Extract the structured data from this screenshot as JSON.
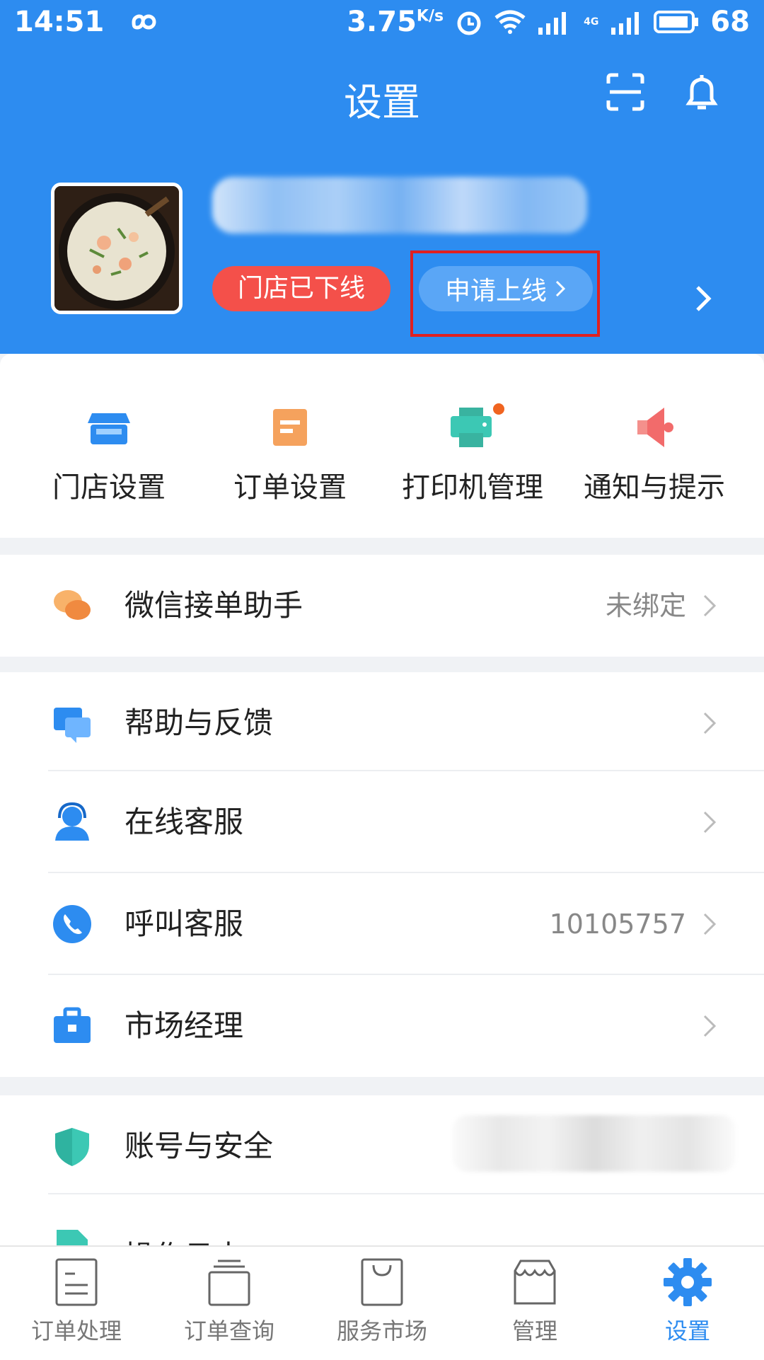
{
  "status_bar": {
    "time": "14:51",
    "speed": "3.75",
    "speed_unit": "K/s",
    "signal_gen": "4G",
    "battery": "68"
  },
  "header": {
    "title": "设置"
  },
  "profile": {
    "store_status": "门店已下线",
    "apply_online_label": "申请上线"
  },
  "shortcuts": [
    {
      "label": "门店设置",
      "icon": "store-icon",
      "color": "#2d8cf0"
    },
    {
      "label": "订单设置",
      "icon": "order-doc-icon",
      "color": "#f5a25d"
    },
    {
      "label": "打印机管理",
      "icon": "printer-icon",
      "color": "#3cc8b4",
      "has_dot": true
    },
    {
      "label": "通知与提示",
      "icon": "speaker-icon",
      "color": "#f26b6b"
    }
  ],
  "menu": {
    "wechat": {
      "label": "微信接单助手",
      "value": "未绑定"
    },
    "help": {
      "label": "帮助与反馈"
    },
    "online_service": {
      "label": "在线客服"
    },
    "call_service": {
      "label": "呼叫客服",
      "value": "10105757"
    },
    "market_manager": {
      "label": "市场经理"
    },
    "account_security": {
      "label": "账号与安全"
    },
    "operation_log": {
      "label": "操作日志"
    }
  },
  "tabs": [
    {
      "label": "订单处理",
      "icon": "order-process-icon"
    },
    {
      "label": "订单查询",
      "icon": "order-query-icon"
    },
    {
      "label": "服务市场",
      "icon": "service-market-icon"
    },
    {
      "label": "管理",
      "icon": "manage-icon"
    },
    {
      "label": "设置",
      "icon": "settings-gear-icon",
      "active": true
    }
  ],
  "colors": {
    "brand": "#2d8cf0",
    "offline_red": "#f4504a"
  }
}
